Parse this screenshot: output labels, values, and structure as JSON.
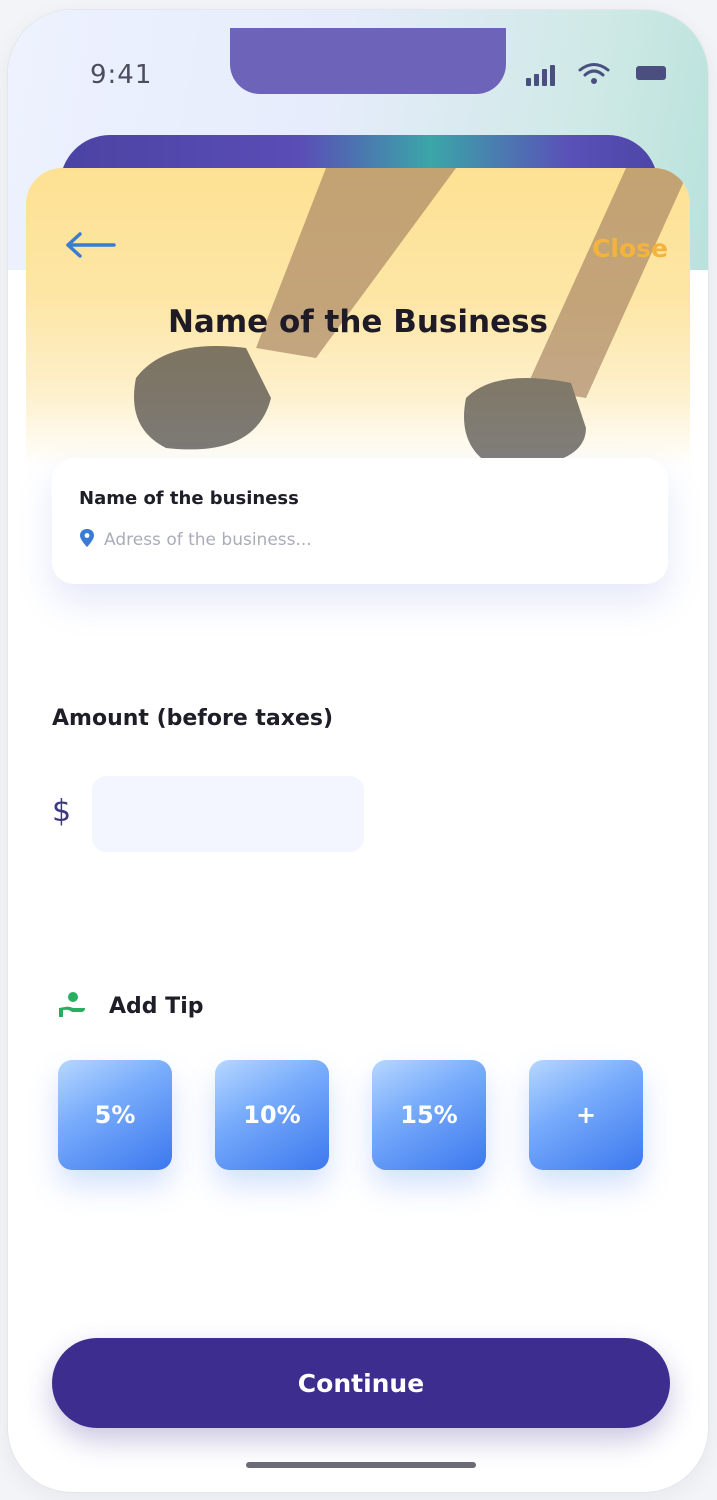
{
  "status_bar": {
    "time": "9:41",
    "icons": [
      "signal-icon",
      "wifi-icon",
      "battery-icon"
    ]
  },
  "header": {
    "back_icon": "arrow-left-icon",
    "close_label": "Close",
    "title": "Name of the Business"
  },
  "business_card": {
    "name": "Name of the business",
    "address_placeholder": "Adress of the business...",
    "pin_icon": "location-pin-icon"
  },
  "amount": {
    "label": "Amount (before taxes)",
    "currency_symbol": "$",
    "value": ""
  },
  "tip": {
    "icon": "hand-user-icon",
    "label": "Add Tip",
    "options": [
      "5%",
      "10%",
      "15%",
      "+"
    ]
  },
  "footer": {
    "continue_label": "Continue"
  },
  "colors": {
    "accent_primary": "#3c2d8f",
    "close_link": "#f4b33c",
    "tip_gradient_end": "#3c78ee",
    "back_arrow": "#3a7bd5",
    "tip_icon": "#27ae60"
  }
}
